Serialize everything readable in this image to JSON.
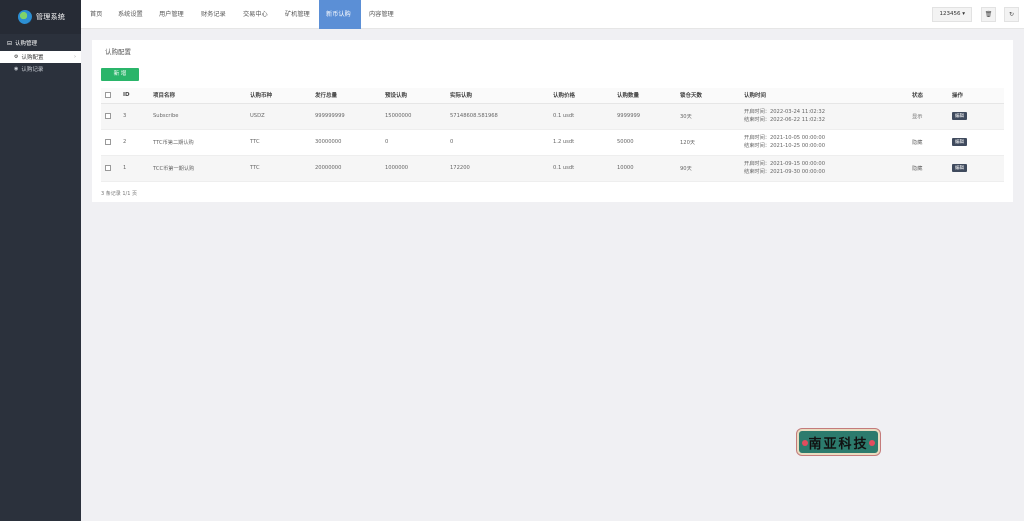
{
  "app": {
    "title": "管理系统"
  },
  "sidebar": {
    "group_label": "认购管理",
    "items": [
      {
        "label": "认购配置"
      },
      {
        "label": "认购记录"
      }
    ]
  },
  "topnav": {
    "tabs": [
      {
        "label": "首页"
      },
      {
        "label": "系统设置"
      },
      {
        "label": "用户管理"
      },
      {
        "label": "财务记录"
      },
      {
        "label": "交易中心"
      },
      {
        "label": "矿机管理"
      },
      {
        "label": "新币认购"
      },
      {
        "label": "内容管理"
      }
    ],
    "active_tab": "新币认购",
    "user": "123456 ▾",
    "delete_icon": "trash-icon",
    "refresh_icon": "refresh-icon"
  },
  "panel": {
    "title": "认购配置",
    "add_label": "新 增"
  },
  "table": {
    "columns": [
      "ID",
      "项目名称",
      "认购币种",
      "发行总量",
      "预设认购",
      "实际认购",
      "认购价格",
      "认购数量",
      "锁仓天数",
      "认购时间",
      "状态",
      "操作"
    ],
    "rows": [
      {
        "id": "3",
        "name": "Subscribe",
        "coin": "USDZ",
        "total": "999999999",
        "preset": "15000000",
        "actual": "57148608.581968",
        "price": "0.1 usdt",
        "qty": "9999999",
        "lock": "30天",
        "start": "开启时间：2022-03-24 11:02:32",
        "end": "结束时间：2022-06-22 11:02:32",
        "status": "显示",
        "op": "编辑"
      },
      {
        "id": "2",
        "name": "TTC币第二期认购",
        "coin": "TTC",
        "total": "30000000",
        "preset": "0",
        "actual": "0",
        "price": "1.2 usdt",
        "qty": "50000",
        "lock": "120天",
        "start": "开启时间：2021-10-05 00:00:00",
        "end": "结束时间：2021-10-25 00:00:00",
        "status": "隐藏",
        "op": "编辑"
      },
      {
        "id": "1",
        "name": "TCC币第一期认购",
        "coin": "TTC",
        "total": "20000000",
        "preset": "1000000",
        "actual": "172200",
        "price": "0.1 usdt",
        "qty": "10000",
        "lock": "90天",
        "start": "开启时间：2021-09-15 00:00:00",
        "end": "结束时间：2021-09-30 00:00:00",
        "status": "隐藏",
        "op": "编辑"
      }
    ],
    "footer": "3 条记录 1/1 页"
  },
  "watermark": {
    "text": "南亚科技"
  }
}
